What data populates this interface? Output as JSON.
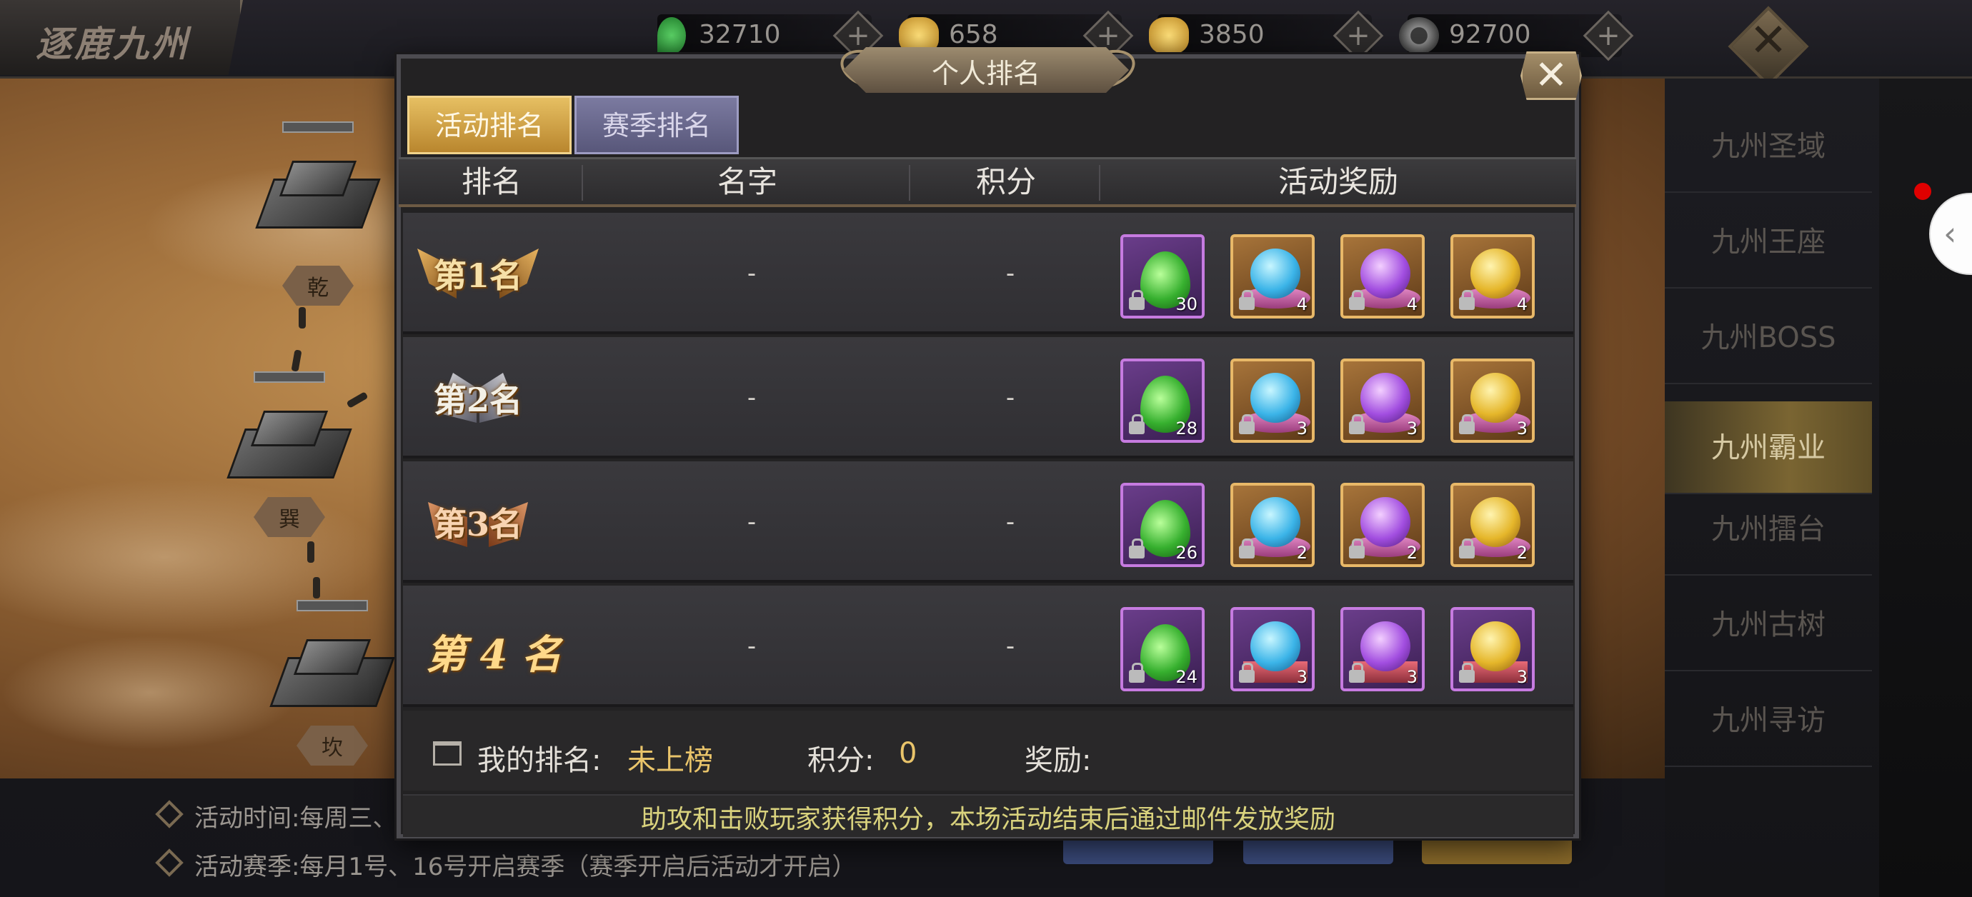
{
  "header": {
    "game_title": "逐鹿九州",
    "resources": [
      {
        "name": "jade",
        "icon": "jade-icon",
        "value": "32710",
        "color": "#2e8b3a"
      },
      {
        "name": "gold-ingot",
        "icon": "gold-ingot-icon",
        "value": "658",
        "color": "#d8a73a"
      },
      {
        "name": "bound-gold",
        "icon": "locked-gold-icon",
        "value": "3850",
        "color": "#d8a73a"
      },
      {
        "name": "coin",
        "icon": "coin-icon",
        "value": "92700",
        "color": "#777777"
      }
    ],
    "plus_symbol": "+",
    "close_symbol": "✕"
  },
  "map": {
    "nodes": [
      {
        "label": "乾"
      },
      {
        "label": "巽"
      },
      {
        "label": "坎"
      }
    ]
  },
  "sidebar": {
    "items": [
      {
        "label": "九州圣域",
        "active": false
      },
      {
        "label": "九州王座",
        "active": false
      },
      {
        "label": "九州BOSS",
        "active": false
      },
      {
        "label": "九州霸业",
        "active": true
      },
      {
        "label": "九州擂台",
        "active": false
      },
      {
        "label": "九州古树",
        "active": false
      },
      {
        "label": "九州寻访",
        "active": false
      }
    ],
    "edge_handle_symbol": "‹"
  },
  "bottom_info": {
    "activity_time": "活动时间:每周三、",
    "activity_season": "活动赛季:每月1号、16号开启赛季（赛季开启后活动才开启）"
  },
  "modal": {
    "title": "个人排名",
    "close_symbol": "✕",
    "tabs": [
      {
        "label": "活动排名",
        "active": true
      },
      {
        "label": "赛季排名",
        "active": false
      }
    ],
    "columns": [
      "排名",
      "名字",
      "积分",
      "活动奖励"
    ],
    "rows": [
      {
        "rank": "第1名",
        "name": "-",
        "score": "-",
        "badge": "gold",
        "rewards": [
          {
            "icon": "green-gem-icon",
            "count": "30"
          },
          {
            "icon": "blue-orb-icon",
            "count": "4"
          },
          {
            "icon": "purple-orb-icon",
            "count": "4"
          },
          {
            "icon": "gold-orb-icon",
            "count": "4"
          }
        ]
      },
      {
        "rank": "第2名",
        "name": "-",
        "score": "-",
        "badge": "silver",
        "rewards": [
          {
            "icon": "green-gem-icon",
            "count": "28"
          },
          {
            "icon": "blue-orb-icon",
            "count": "3"
          },
          {
            "icon": "purple-orb-icon",
            "count": "3"
          },
          {
            "icon": "gold-orb-icon",
            "count": "3"
          }
        ]
      },
      {
        "rank": "第3名",
        "name": "-",
        "score": "-",
        "badge": "bronze",
        "rewards": [
          {
            "icon": "green-gem-icon",
            "count": "26"
          },
          {
            "icon": "blue-orb-icon",
            "count": "2"
          },
          {
            "icon": "purple-orb-icon",
            "count": "2"
          },
          {
            "icon": "gold-orb-icon",
            "count": "2"
          }
        ]
      },
      {
        "rank": "第 4 名",
        "name": "-",
        "score": "-",
        "badge": "none",
        "rewards": [
          {
            "icon": "green-gem-icon",
            "count": "24"
          },
          {
            "icon": "blue-orb-box-icon",
            "count": "3"
          },
          {
            "icon": "purple-orb-box-icon",
            "count": "3"
          },
          {
            "icon": "gold-orb-box-icon",
            "count": "3"
          }
        ]
      }
    ],
    "footer": {
      "my_rank_label": "我的排名:",
      "my_rank_value": "未上榜",
      "score_label": "积分:",
      "score_value": "0",
      "reward_label": "奖励:"
    },
    "tip": "助攻和击败玩家获得积分，本场活动结束后通过邮件发放奖励"
  }
}
